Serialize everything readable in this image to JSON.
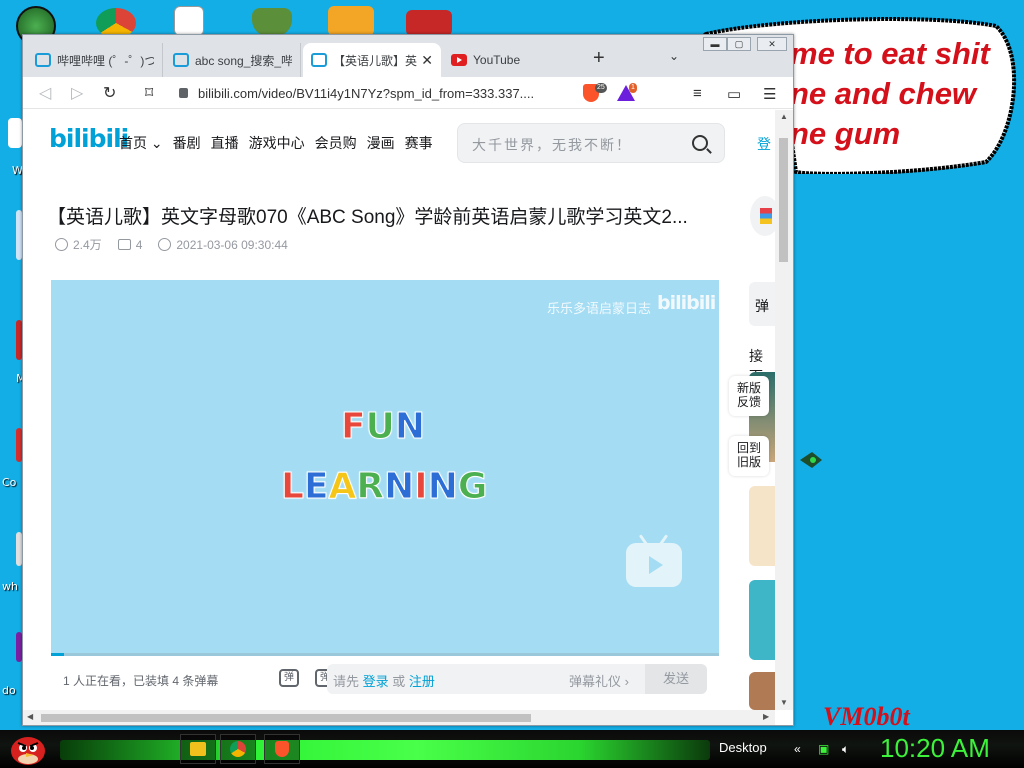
{
  "desktop": {
    "icons": [
      {
        "label": "",
        "color": "#2e7d32"
      },
      {
        "label": "W",
        "color": "#ffffff"
      },
      {
        "label": "",
        "color": "#c62828"
      },
      {
        "label": "M",
        "color": "#c62828"
      },
      {
        "label": "Co",
        "color": "#d32f2f"
      },
      {
        "label": "wh",
        "color": "#e0e0e0"
      },
      {
        "label": "do",
        "color": "#7b1fa2"
      }
    ],
    "bubble_text": "me to eat shit\nne and chew\nne gum",
    "watermark_tag": "VM0b0t"
  },
  "browser": {
    "tabs": [
      {
        "label": "哔哩哔哩 (゜-゜)つ",
        "icon": "bilibili-tv-icon",
        "active": false
      },
      {
        "label": "abc song_搜索_哔哩",
        "icon": "bilibili-tv-icon",
        "active": false
      },
      {
        "label": "【英语儿歌】英文",
        "icon": "bilibili-tv-icon",
        "active": true
      },
      {
        "label": "YouTube",
        "icon": "youtube-icon",
        "active": false
      }
    ],
    "new_tab": "+",
    "tab_menu": "⌄",
    "url": "bilibili.com/video/BV11i4y1N7Yz?spm_id_from=333.337....",
    "brave_shield_count": "25",
    "rewards_count": "1"
  },
  "page": {
    "logo": "bilibili",
    "nav": [
      "首页 ⌄",
      "番剧",
      "直播",
      "游戏中心",
      "会员购",
      "漫画",
      "赛事"
    ],
    "search_placeholder": "大千世界，无我不断！",
    "login": "登",
    "video": {
      "title": "【英语儿歌】英文字母歌070《ABC Song》学龄前英语启蒙儿歌学习英文2...",
      "views": "2.4万",
      "danmaku": "4",
      "date": "2021-03-06 09:30:44"
    },
    "player": {
      "watermark_text": "乐乐多语启蒙日志",
      "watermark_logo": "bilibili",
      "line1": [
        "F",
        "U",
        "N"
      ],
      "line2": [
        "L",
        "E",
        "A",
        "R",
        "N",
        "I",
        "N",
        "G"
      ],
      "line1_colors": [
        "#e8483b",
        "#4caf50",
        "#2d6ed6"
      ],
      "line2_colors": [
        "#e8483b",
        "#2d6ed6",
        "#f5c518",
        "#4caf50",
        "#2d6ed6",
        "#e8483b",
        "#2d6ed6",
        "#4caf50",
        "#f5c518"
      ],
      "progress": 0.02
    },
    "danmaku_bar": {
      "watching": "1 人正在看，已装填 4 条弹幕",
      "toggle1": "弹",
      "toggle2": "弹",
      "prompt_pre": "请先",
      "login_link": "登录",
      "or": "或",
      "register_link": "注册",
      "etiquette": "弹幕礼仪 ›",
      "send": "发送"
    },
    "right_side": {
      "danmaku_tab": "弹",
      "next_label": "接下",
      "new_version": "新版\n反馈",
      "old_version": "回到\n旧版"
    }
  },
  "taskbar": {
    "desktop_label": "Desktop",
    "clock": "10:20 AM"
  }
}
